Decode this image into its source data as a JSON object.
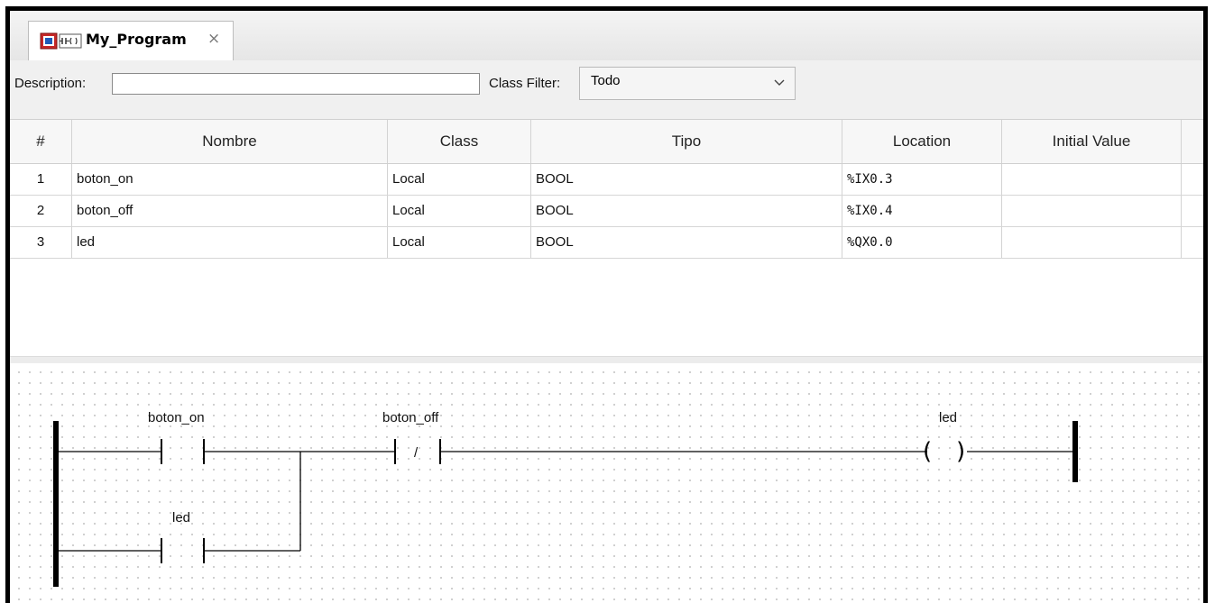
{
  "tab": {
    "title": "My_Program",
    "close": "×"
  },
  "filter": {
    "description_label": "Description:",
    "description_value": "",
    "class_filter_label": "Class Filter:",
    "class_filter_value": "Todo"
  },
  "table": {
    "headers": [
      "#",
      "Nombre",
      "Class",
      "Tipo",
      "Location",
      "Initial Value"
    ],
    "rows": [
      {
        "num": "1",
        "nombre": "boton_on",
        "class": "Local",
        "tipo": "BOOL",
        "location": "%IX0.3",
        "initial": ""
      },
      {
        "num": "2",
        "nombre": "boton_off",
        "class": "Local",
        "tipo": "BOOL",
        "location": "%IX0.4",
        "initial": ""
      },
      {
        "num": "3",
        "nombre": "led",
        "class": "Local",
        "tipo": "BOOL",
        "location": "%QX0.0",
        "initial": ""
      }
    ]
  },
  "ladder": {
    "contact_boton_on": "boton_on",
    "contact_boton_off": "boton_off",
    "contact_boton_off_symbol": "/",
    "contact_led": "led",
    "coil_led": "led",
    "coil_left": "(",
    "coil_right": ")"
  },
  "colors": {
    "rail": "#000000",
    "grid_dot": "#c4c4c4"
  }
}
